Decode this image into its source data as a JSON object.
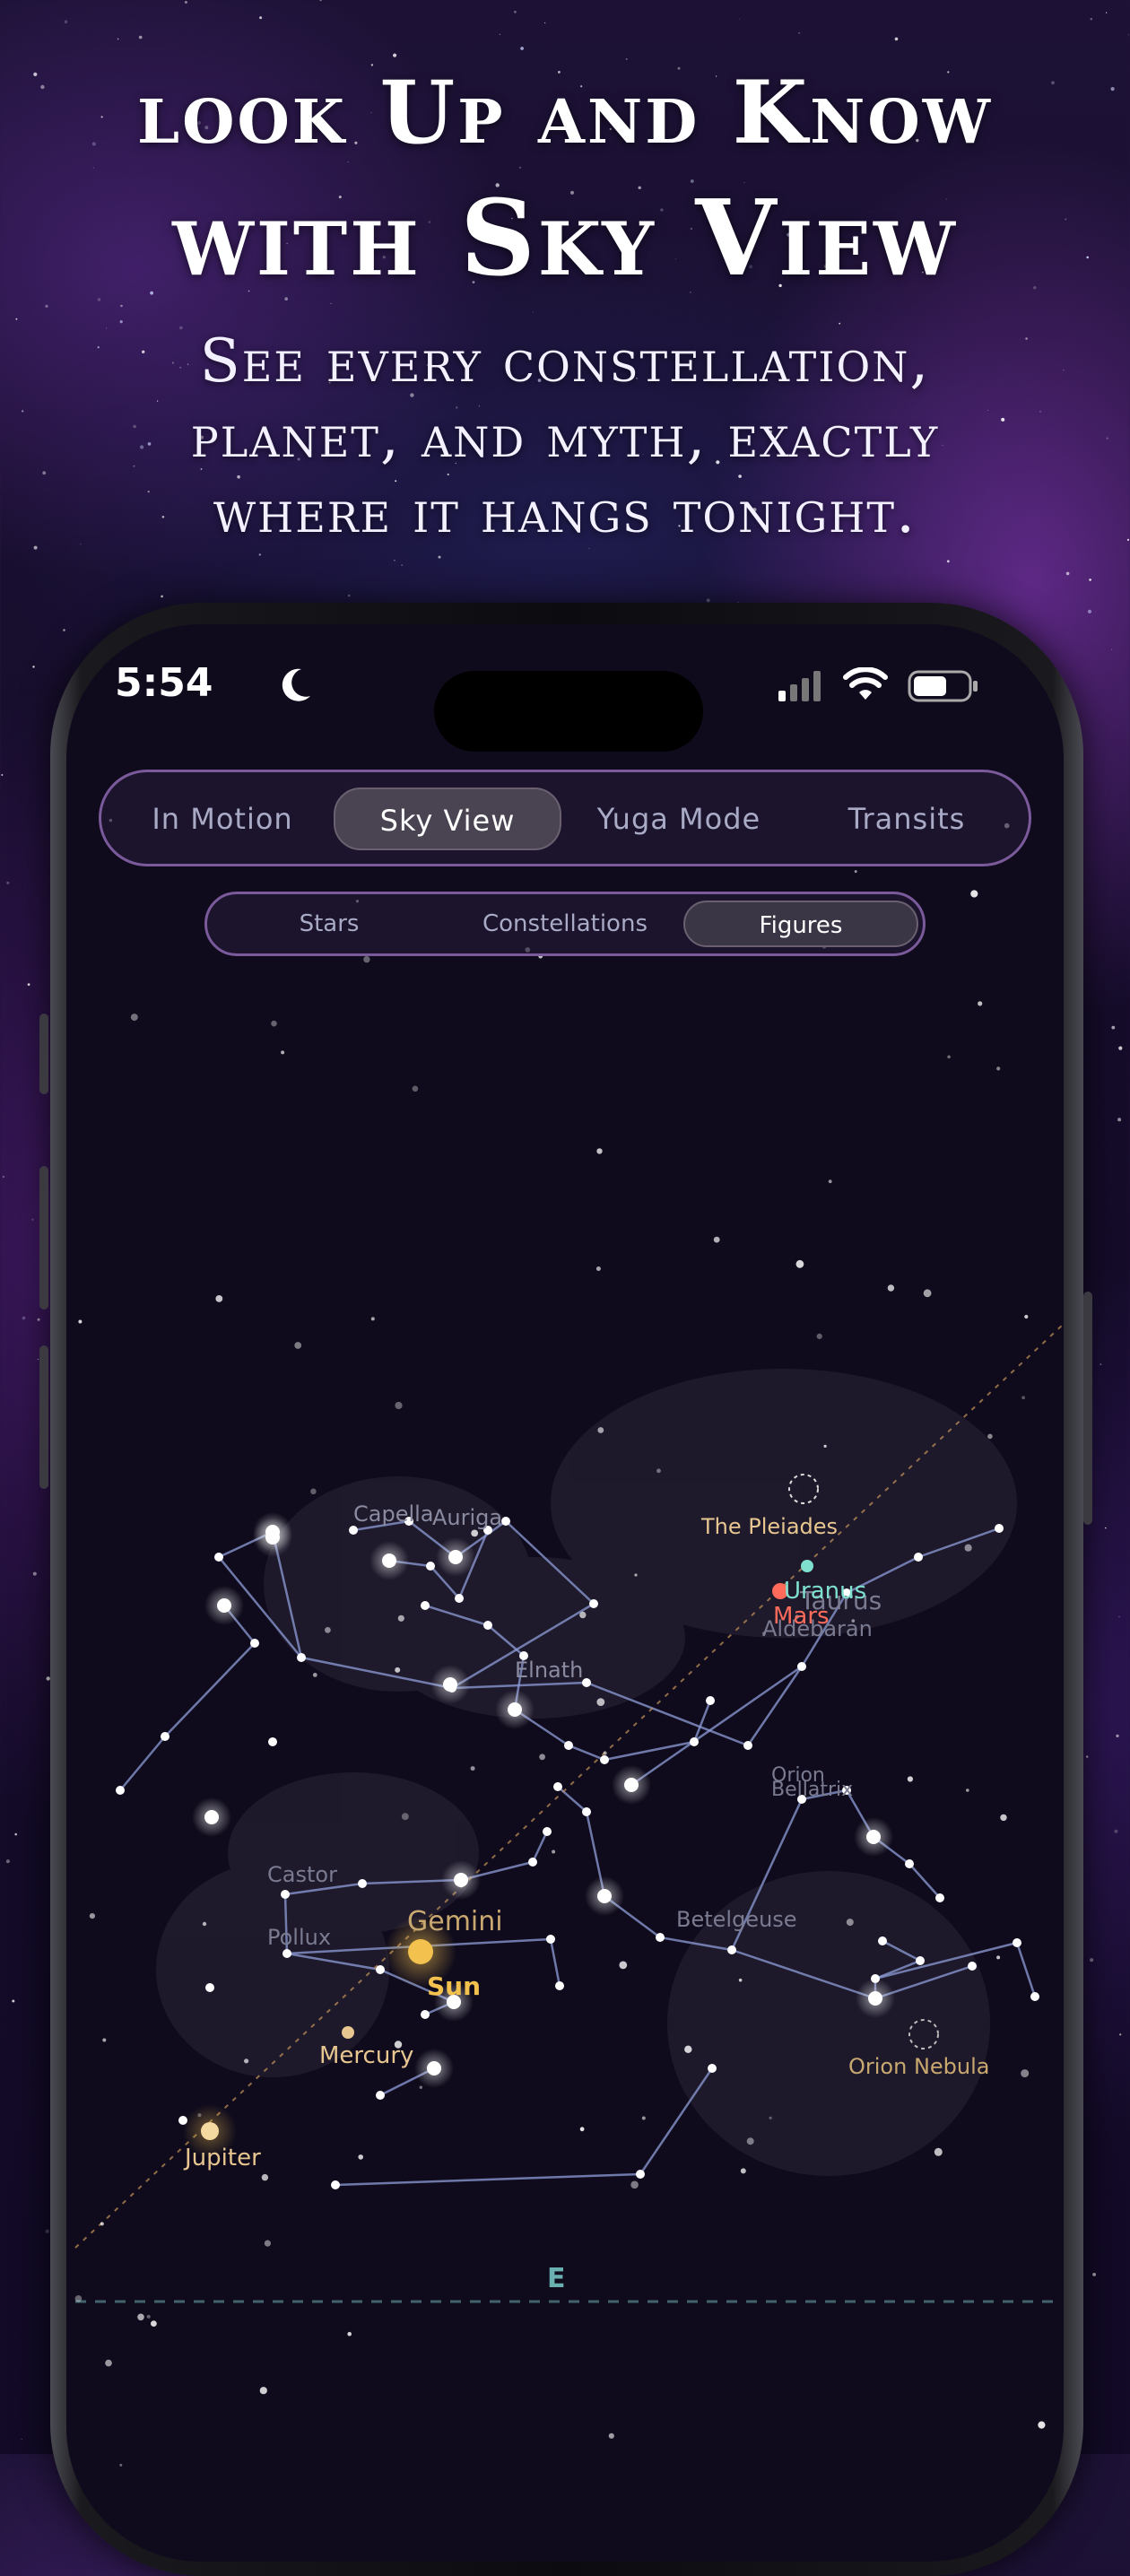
{
  "headline": {
    "line1": "look Up and Know",
    "line2": "with Sky View",
    "sub1": "See every constellation,",
    "sub2": "planet, and myth, exactly",
    "sub3": "where it hangs tonight."
  },
  "status_bar": {
    "time": "5:54",
    "moon_icon": "crescent-moon-icon",
    "signal_icon": "cellular-signal-icon",
    "wifi_icon": "wifi-icon",
    "battery_icon": "battery-icon"
  },
  "tabs": [
    "In Motion",
    "Sky View",
    "Yuga Mode",
    "Transits"
  ],
  "active_tab": "Sky View",
  "subtabs": [
    "Stars",
    "Constellations",
    "Figures"
  ],
  "active_subtab": "Figures",
  "sky_labels": {
    "capella": "Capella",
    "auriga": "Auriga",
    "elnath": "Elnath",
    "pleiades": "The Pleiades",
    "uranus": "Uranus",
    "taurus": "Taurus",
    "mars": "Mars",
    "aldebaran": "Aldebaran",
    "orion": "Orion",
    "bellatrix": "Bellatrix",
    "betelgeuse": "Betelgeuse",
    "castor": "Castor",
    "pollux": "Pollux",
    "gemini": "Gemini",
    "sun": "Sun",
    "mercury": "Mercury",
    "jupiter": "Jupiter",
    "orion_nebula": "Orion Nebula",
    "horizon_east": "E"
  },
  "colors": {
    "accent_purple": "#7a5a9a",
    "constellation_line": "#8e9ed8",
    "planet_gold": "#f2c14e",
    "mars_red": "#ff6b5a",
    "uranus_teal": "#7fe0d0",
    "ecliptic": "#c7955a"
  }
}
